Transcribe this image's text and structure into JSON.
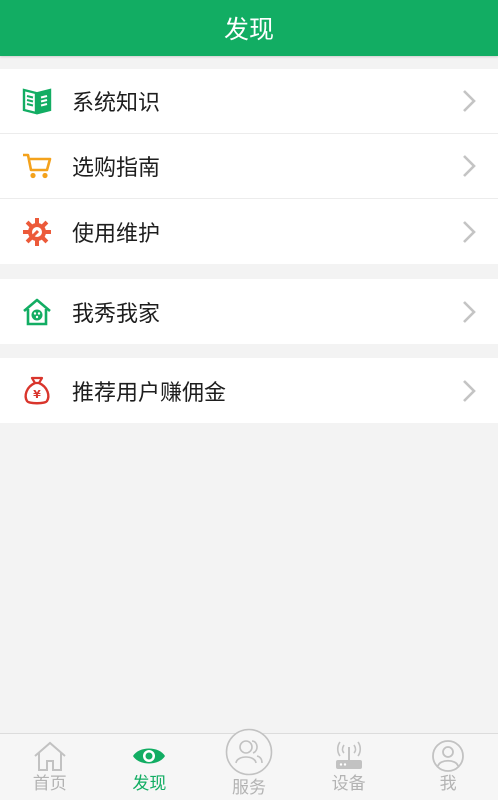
{
  "header": {
    "title": "发现"
  },
  "groups": [
    {
      "items": [
        {
          "label": "系统知识",
          "icon": "book-icon",
          "color": "#12ad63"
        },
        {
          "label": "选购指南",
          "icon": "cart-icon",
          "color": "#f4a21c"
        },
        {
          "label": "使用维护",
          "icon": "gear-wrench-icon",
          "color": "#ec5a3a"
        }
      ]
    },
    {
      "items": [
        {
          "label": "我秀我家",
          "icon": "house-icon",
          "color": "#12ad63"
        }
      ]
    },
    {
      "items": [
        {
          "label": "推荐用户赚佣金",
          "icon": "money-bag-icon",
          "color": "#d9352c"
        }
      ]
    }
  ],
  "tabbar": {
    "tabs": [
      {
        "label": "首页",
        "icon": "home-icon",
        "active": false
      },
      {
        "label": "发现",
        "icon": "eye-icon",
        "active": true
      },
      {
        "label": "服务",
        "icon": "users-icon",
        "active": false
      },
      {
        "label": "设备",
        "icon": "router-icon",
        "active": false
      },
      {
        "label": "我",
        "icon": "person-icon",
        "active": false
      }
    ]
  },
  "colors": {
    "brand": "#12ad63",
    "inactive": "#b3b3b3",
    "background": "#f3f3f3"
  }
}
